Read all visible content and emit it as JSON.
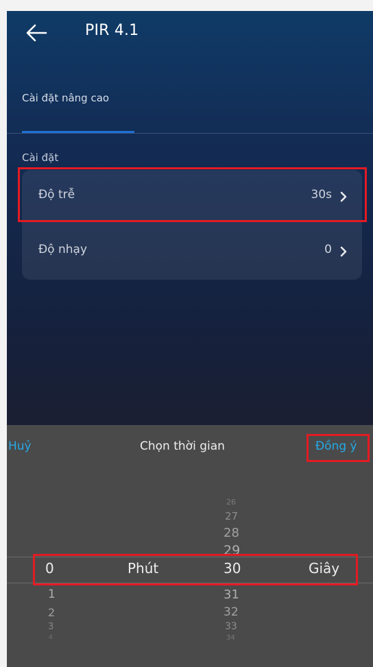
{
  "header": {
    "title": "PIR 4.1",
    "back_icon": "arrow-left-icon"
  },
  "tabs": {
    "active_label": "Cài đặt nâng cao",
    "indicator_color": "#1e6fd6"
  },
  "settings": {
    "section_label": "Cài đặt",
    "rows": [
      {
        "label": "Độ trễ",
        "value": "30s"
      },
      {
        "label": "Độ nhạy",
        "value": "0"
      }
    ]
  },
  "time_picker": {
    "cancel_label": "Huỷ",
    "title": "Chọn thời gian",
    "confirm_label": "Đồng ý",
    "minutes": {
      "above": [],
      "selected": "0",
      "below": [
        "1",
        "2",
        "3",
        "4"
      ],
      "unit_label": "Phút"
    },
    "seconds": {
      "above": [
        "26",
        "27",
        "28",
        "29"
      ],
      "selected": "30",
      "below": [
        "31",
        "32",
        "33",
        "34"
      ],
      "unit_label": "Giây"
    }
  },
  "colors": {
    "accent_blue": "#26a9e6",
    "highlight_red": "#e31b23",
    "sheet_bg": "#4a4a4a"
  }
}
